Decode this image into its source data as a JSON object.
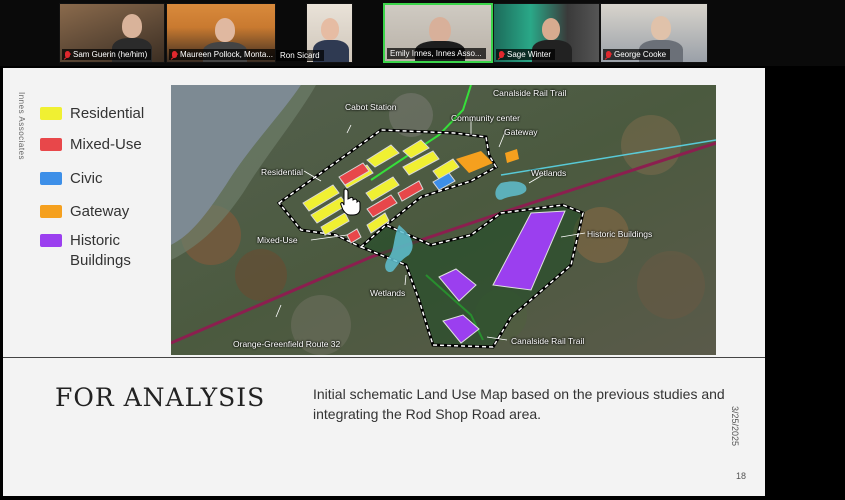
{
  "participants": [
    {
      "name": "Sam Guerin (he/him)",
      "muted": true,
      "active": false
    },
    {
      "name": "Maureen Pollock, Monta...",
      "muted": true,
      "active": false
    },
    {
      "name": "Ron Sicard",
      "muted": false,
      "active": false
    },
    {
      "name": "Emily Innes, Innes Asso...",
      "muted": false,
      "active": true
    },
    {
      "name": "Sage Winter",
      "muted": true,
      "active": false
    },
    {
      "name": "George Cooke",
      "muted": true,
      "active": false
    }
  ],
  "slide": {
    "side_text": "Innes Associates",
    "legend": [
      {
        "label": "Residential",
        "color": "#f0f032"
      },
      {
        "label": "Mixed-Use",
        "color": "#e8474a"
      },
      {
        "label": "Civic",
        "color": "#3d8fe8"
      },
      {
        "label": "Gateway",
        "color": "#f5a01e"
      },
      {
        "label": "Historic\nBuildings",
        "color": "#9b3fef"
      }
    ],
    "map_labels": {
      "canalside_rail_trail_top": "Canalside Rail Trail",
      "cabot_station": "Cabot Station",
      "community_center": "Community center",
      "gateway": "Gateway",
      "residential": "Residential",
      "wetlands_right": "Wetlands",
      "historic_buildings": "Historic Buildings",
      "mixed_use": "Mixed-Use",
      "wetlands_bottom": "Wetlands",
      "orange_greenfield_route": "Orange-Greenfield Route 32",
      "canalside_rail_trail_bottom": "Canalside Rail Trail"
    },
    "title": "FOR ANALYSIS",
    "description": "Initial schematic Land Use Map based on the previous studies and integrating the Rod Shop Road area.",
    "date": "3/25/2025",
    "page_number": "18"
  }
}
